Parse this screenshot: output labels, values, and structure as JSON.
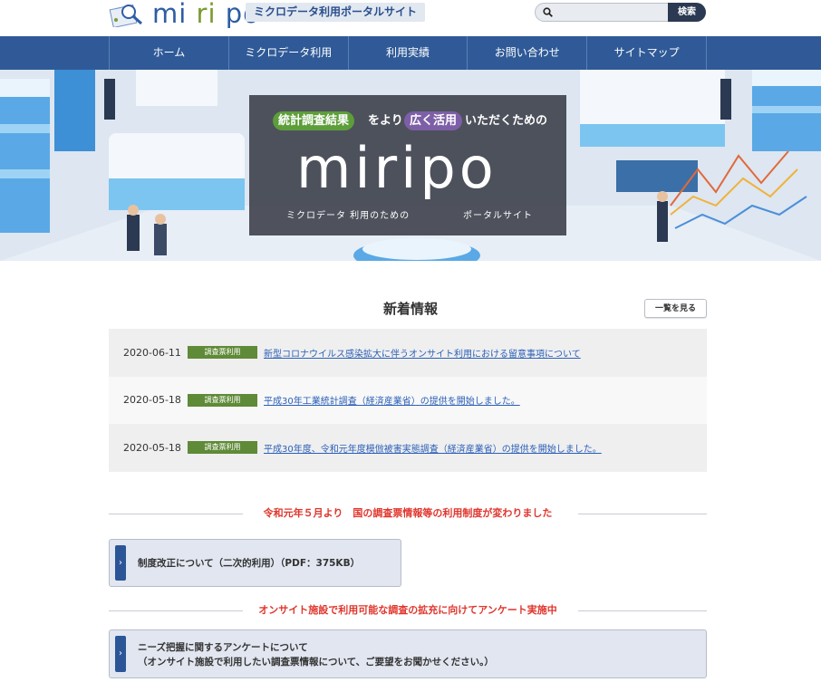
{
  "header": {
    "logo": "mi ri po",
    "logo_parts": [
      "mi",
      "ri",
      "po"
    ],
    "tagline": "ミクロデータ利用ポータルサイト",
    "search_button": "検索",
    "search_placeholder": ""
  },
  "nav": {
    "items": [
      {
        "label": "ホーム"
      },
      {
        "label": "ミクロデータ利用"
      },
      {
        "label": "利用実績"
      },
      {
        "label": "お問い合わせ"
      },
      {
        "label": "サイトマップ"
      }
    ]
  },
  "hero": {
    "tag1": "統計調査結果",
    "mid1": "をより",
    "tag2": "広く活用",
    "mid2": "いただくための",
    "brand": "miripo",
    "sub_left": "ミクロデータ 利用のための",
    "sub_right": "ポータルサイト"
  },
  "news": {
    "title": "新着情報",
    "view_all": "一覧を見る",
    "items": [
      {
        "date": "2020-06-11",
        "badge": "調査票利用",
        "text": "新型コロナウイルス感染拡大に伴うオンサイト利用における留意事項について"
      },
      {
        "date": "2020-05-18",
        "badge": "調査票利用",
        "text": "平成30年工業統計調査（経済産業省）の提供を開始しました。"
      },
      {
        "date": "2020-05-18",
        "badge": "調査票利用",
        "text": "平成30年度、令和元年度模倣被害実態調査（経済産業省）の提供を開始しました。"
      }
    ]
  },
  "section1": {
    "heading": "令和元年５月より　国の調査票情報等の利用制度が変わりました",
    "link": "制度改正について（二次的利用）（PDF：375KB）"
  },
  "section2": {
    "heading": "オンサイト施設で利用可能な調査の拡充に向けてアンケート実施中",
    "link_line1": "ニーズ把握に関するアンケートについて",
    "link_line2": "（オンサイト施設で利用したい調査票情報について、ご要望をお聞かせください。）"
  },
  "colors": {
    "nav": "#2f5a97",
    "badge": "#5f8a37",
    "alert": "#e0362d",
    "link": "#2b5fb8"
  }
}
